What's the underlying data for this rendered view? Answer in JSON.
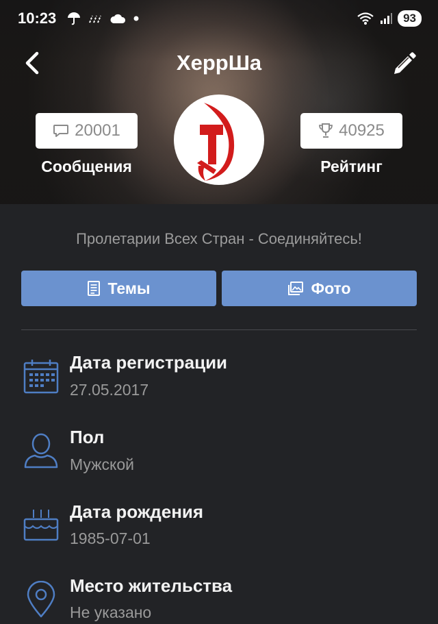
{
  "status_bar": {
    "time": "10:23",
    "battery": "93",
    "left_icons": [
      "umbrella-icon",
      "rain-icon",
      "cloud-icon",
      "dot-icon"
    ],
    "right_icons": [
      "wifi-icon",
      "signal-icon"
    ]
  },
  "header": {
    "title": "ХеррШа",
    "back_icon": "chevron-left-icon",
    "edit_icon": "pencil-icon"
  },
  "stats": {
    "messages": {
      "count": "20001",
      "label": "Сообщения",
      "icon": "chat-bubble-icon"
    },
    "rating": {
      "count": "40925",
      "label": "Рейтинг",
      "icon": "trophy-icon"
    }
  },
  "profile": {
    "motto": "Пролетарии Всех Стран - Соединяйтесь!",
    "avatar_icon": "hammer-and-sickle-icon",
    "avatar_color": "#d21c1c"
  },
  "actions": {
    "topics_label": "Темы",
    "photos_label": "Фото"
  },
  "info": [
    {
      "label": "Дата регистрации",
      "value": "27.05.2017",
      "icon": "calendar-icon"
    },
    {
      "label": "Пол",
      "value": "Мужской",
      "icon": "person-icon"
    },
    {
      "label": "Дата рождения",
      "value": "1985-07-01",
      "icon": "birthday-cake-icon"
    },
    {
      "label": "Место жительства",
      "value": "Не указано",
      "icon": "location-pin-icon"
    }
  ],
  "colors": {
    "accent": "#6b92cf",
    "background": "#222326",
    "icon_blue": "#4f7ec4"
  }
}
